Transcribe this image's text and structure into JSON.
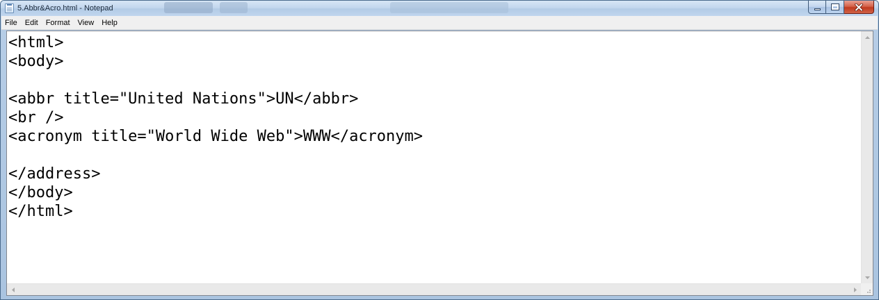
{
  "window": {
    "title": "5.Abbr&Acro.html - Notepad"
  },
  "menu": {
    "items": [
      "File",
      "Edit",
      "Format",
      "View",
      "Help"
    ]
  },
  "editor": {
    "lines": [
      "<html>",
      "<body>",
      "",
      "<abbr title=\"United Nations\">UN</abbr>",
      "<br />",
      "<acronym title=\"World Wide Web\">WWW</acronym>",
      "",
      "</address>",
      "</body>",
      "</html>"
    ]
  },
  "icons": {
    "app": "notepad-icon",
    "minimize": "minimize-icon",
    "maximize": "maximize-icon",
    "close": "close-icon",
    "scroll_up": "arrow-up-icon",
    "scroll_down": "arrow-down-icon",
    "scroll_left": "arrow-left-icon",
    "scroll_right": "arrow-right-icon"
  },
  "colors": {
    "close_button": "#c03a1f",
    "title_bar": "#c3d7ee",
    "menu_bar": "#f0f0f0",
    "text": "#000000"
  }
}
